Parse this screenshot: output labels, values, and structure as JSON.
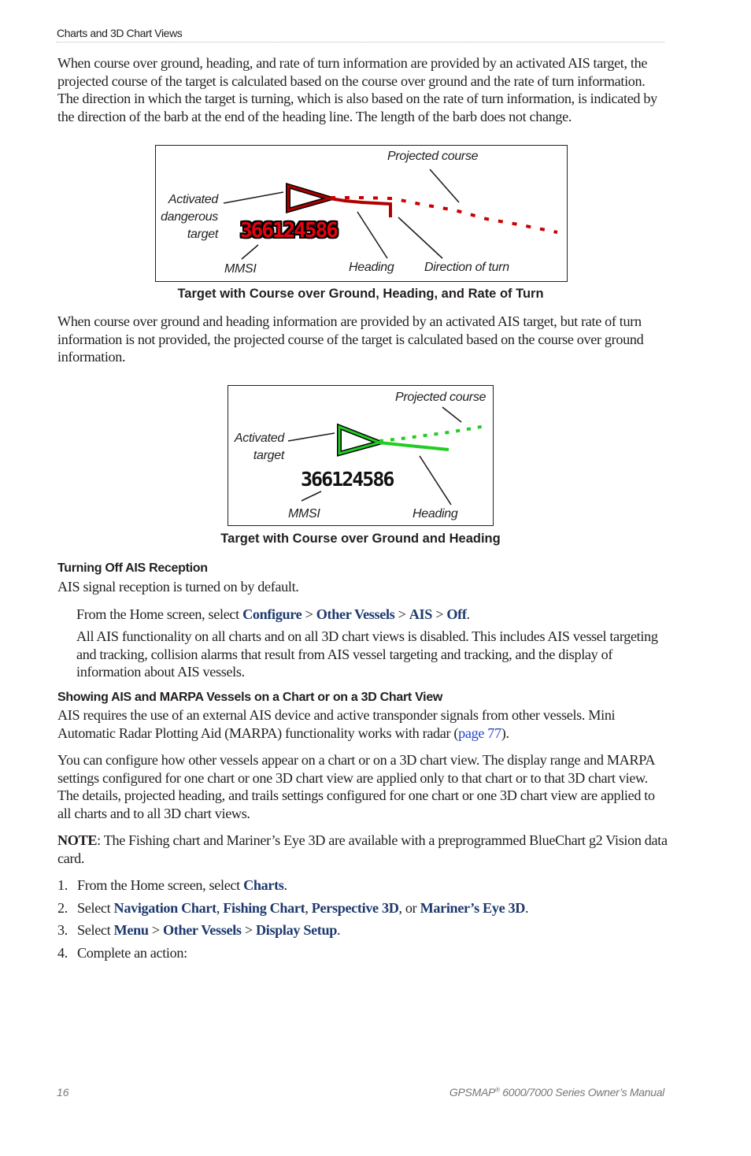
{
  "header": {
    "section_title": "Charts and 3D Chart Views"
  },
  "intro_paragraph": "When course over ground, heading, and rate of turn information are provided by an activated AIS target, the projected course of the target is calculated based on the course over ground and the rate of turn information. The direction in which the target is turning, which is also based on the rate of turn information, is indicated by the direction of the barb at the end of the heading line. The length of the barb does not change.",
  "figure1": {
    "labels": {
      "projected_course": "Projected course",
      "activated": "Activated",
      "dangerous": "dangerous",
      "target": "target",
      "mmsi": "MMSI",
      "heading": "Heading",
      "direction_of_turn": "Direction of turn"
    },
    "mmsi_value": "366124586",
    "symbol_color": "#b00000",
    "mmsi_color": "#e8000f",
    "caption": "Target with Course over Ground, Heading, and Rate of Turn"
  },
  "second_paragraph": "When course over ground and heading information are provided by an activated AIS target, but rate of turn information is not provided, the projected course of the target is calculated based on the course over ground information.",
  "figure2": {
    "labels": {
      "projected_course": "Projected course",
      "activated": "Activated",
      "target": "target",
      "mmsi": "MMSI",
      "heading": "Heading"
    },
    "mmsi_value": "366124586",
    "symbol_color": "#22cc22",
    "caption": "Target with Course over Ground and Heading"
  },
  "section_turning_off": {
    "heading": "Turning Off AIS Reception",
    "intro": "AIS signal reception is turned on by default.",
    "instruction_prefix": "From the Home screen, select ",
    "path": [
      "Configure",
      "Other Vessels",
      "AIS",
      "Off"
    ],
    "separator": " > ",
    "result": "All AIS functionality on all charts and on all 3D chart views is disabled. This includes AIS vessel targeting and tracking, collision alarms that result from AIS vessel targeting and tracking, and the display of information about AIS vessels."
  },
  "section_showing": {
    "heading": "Showing AIS and  MARPA Vessels on a Chart or on a 3D Chart View",
    "para1_text": "AIS requires the use of an external AIS device and active transponder signals from other vessels. Mini Automatic Radar Plotting Aid (MARPA) functionality works with radar (",
    "para1_link": "page 77",
    "para1_end": ").",
    "para2": "You can configure how other vessels appear on a chart or on a 3D chart view. The display range and MARPA settings configured for one chart or one 3D chart view are applied only to that chart or to that 3D chart view. The details, projected heading, and trails settings configured for one chart or one 3D chart view are applied to all charts and to all 3D chart views.",
    "note_label": "NOTE",
    "note_text": ": The Fishing chart and Mariner’s Eye 3D are available with a preprogrammed BlueChart g2 Vision data card.",
    "steps": [
      {
        "num": "1.",
        "prefix": "From the Home screen, select ",
        "items": [
          "Charts"
        ],
        "suffix": "."
      },
      {
        "num": "2.",
        "prefix": "Select ",
        "items": [
          "Navigation Chart",
          "Fishing Chart",
          "Perspective 3D",
          "Mariner’s Eye 3D"
        ],
        "suffix": "."
      },
      {
        "num": "3.",
        "prefix": "Select ",
        "items": [
          "Menu",
          "Other Vessels",
          "Display Setup"
        ],
        "suffix": "."
      },
      {
        "num": "4.",
        "text": "Complete an action:"
      }
    ],
    "step2_sep1": ", ",
    "step2_sep2": ", ",
    "step2_sep3": ", or ",
    "step3_sep": " > "
  },
  "footer": {
    "page_number": "16",
    "manual_title_pre": "GPSMAP",
    "manual_title_reg": "®",
    "manual_title_post": " 6000/7000 Series Owner’s Manual"
  }
}
